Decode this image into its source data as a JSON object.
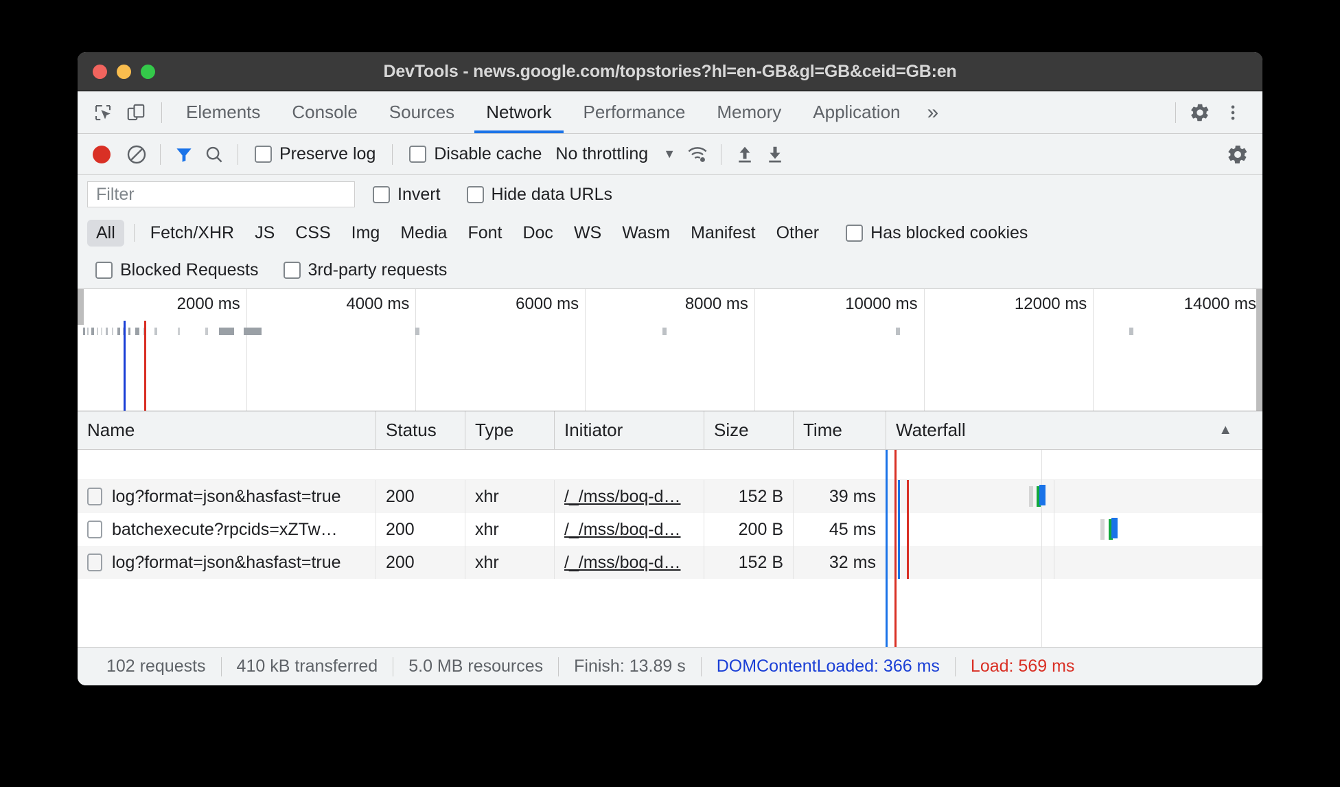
{
  "window": {
    "title": "DevTools - news.google.com/topstories?hl=en-GB&gl=GB&ceid=GB:en"
  },
  "tabbar": {
    "inspect_icon": "inspect-element-icon",
    "device_icon": "device-toolbar-icon",
    "tabs": [
      {
        "label": "Elements",
        "active": false
      },
      {
        "label": "Console",
        "active": false
      },
      {
        "label": "Sources",
        "active": false
      },
      {
        "label": "Network",
        "active": true
      },
      {
        "label": "Performance",
        "active": false
      },
      {
        "label": "Memory",
        "active": false
      },
      {
        "label": "Application",
        "active": false
      }
    ],
    "more_tabs": "»",
    "settings_icon": "gear-icon",
    "menu_icon": "kebab-menu-icon"
  },
  "toolbar": {
    "record_icon": "record-button-icon",
    "clear_icon": "clear-network-log-icon",
    "filter_icon": "filter-funnel-icon",
    "search_icon": "search-icon",
    "preserve_log": {
      "label": "Preserve log",
      "checked": false
    },
    "disable_cache": {
      "label": "Disable cache",
      "checked": false
    },
    "throttling": {
      "value": "No throttling",
      "caret": "▼"
    },
    "network_conditions_icon": "wifi-settings-icon",
    "upload_icon": "import-har-icon",
    "download_icon": "export-har-icon",
    "settings_icon": "gear-icon"
  },
  "filterbar": {
    "input": {
      "value": "",
      "placeholder": "Filter"
    },
    "invert": {
      "label": "Invert",
      "checked": false
    },
    "hide_data_urls": {
      "label": "Hide data URLs",
      "checked": false
    }
  },
  "typefilter": {
    "types": [
      {
        "label": "All",
        "active": true
      },
      {
        "label": "Fetch/XHR",
        "active": false
      },
      {
        "label": "JS",
        "active": false
      },
      {
        "label": "CSS",
        "active": false
      },
      {
        "label": "Img",
        "active": false
      },
      {
        "label": "Media",
        "active": false
      },
      {
        "label": "Font",
        "active": false
      },
      {
        "label": "Doc",
        "active": false
      },
      {
        "label": "WS",
        "active": false
      },
      {
        "label": "Wasm",
        "active": false
      },
      {
        "label": "Manifest",
        "active": false
      },
      {
        "label": "Other",
        "active": false
      }
    ],
    "has_blocked_cookies": {
      "label": "Has blocked cookies",
      "checked": false
    },
    "blocked_requests": {
      "label": "Blocked Requests",
      "checked": false
    },
    "third_party_requests": {
      "label": "3rd-party requests",
      "checked": false
    }
  },
  "overview": {
    "ticks": [
      "2000 ms",
      "4000 ms",
      "6000 ms",
      "8000 ms",
      "10000 ms",
      "12000 ms",
      "14000 ms"
    ],
    "dcl_marker_color": "#1a3fd6",
    "load_marker_color": "#d93025"
  },
  "table": {
    "columns": [
      "Name",
      "Status",
      "Type",
      "Initiator",
      "Size",
      "Time",
      "Waterfall"
    ],
    "sort_indicator": "▲",
    "rows": [
      {
        "name": "log?format=json&hasfast=true",
        "status": "200",
        "type": "xhr",
        "initiator": "/_/mss/boq-d…",
        "size": "152 B",
        "time": "39 ms"
      },
      {
        "name": "batchexecute?rpcids=xZTw…",
        "status": "200",
        "type": "xhr",
        "initiator": "/_/mss/boq-d…",
        "size": "200 B",
        "time": "45 ms"
      },
      {
        "name": "log?format=json&hasfast=true",
        "status": "200",
        "type": "xhr",
        "initiator": "/_/mss/boq-d…",
        "size": "152 B",
        "time": "32 ms"
      }
    ]
  },
  "statusbar": {
    "requests": "102 requests",
    "transferred": "410 kB transferred",
    "resources": "5.0 MB resources",
    "finish": "Finish: 13.89 s",
    "dom_content_loaded": "DOMContentLoaded: 366 ms",
    "load": "Load: 569 ms"
  }
}
